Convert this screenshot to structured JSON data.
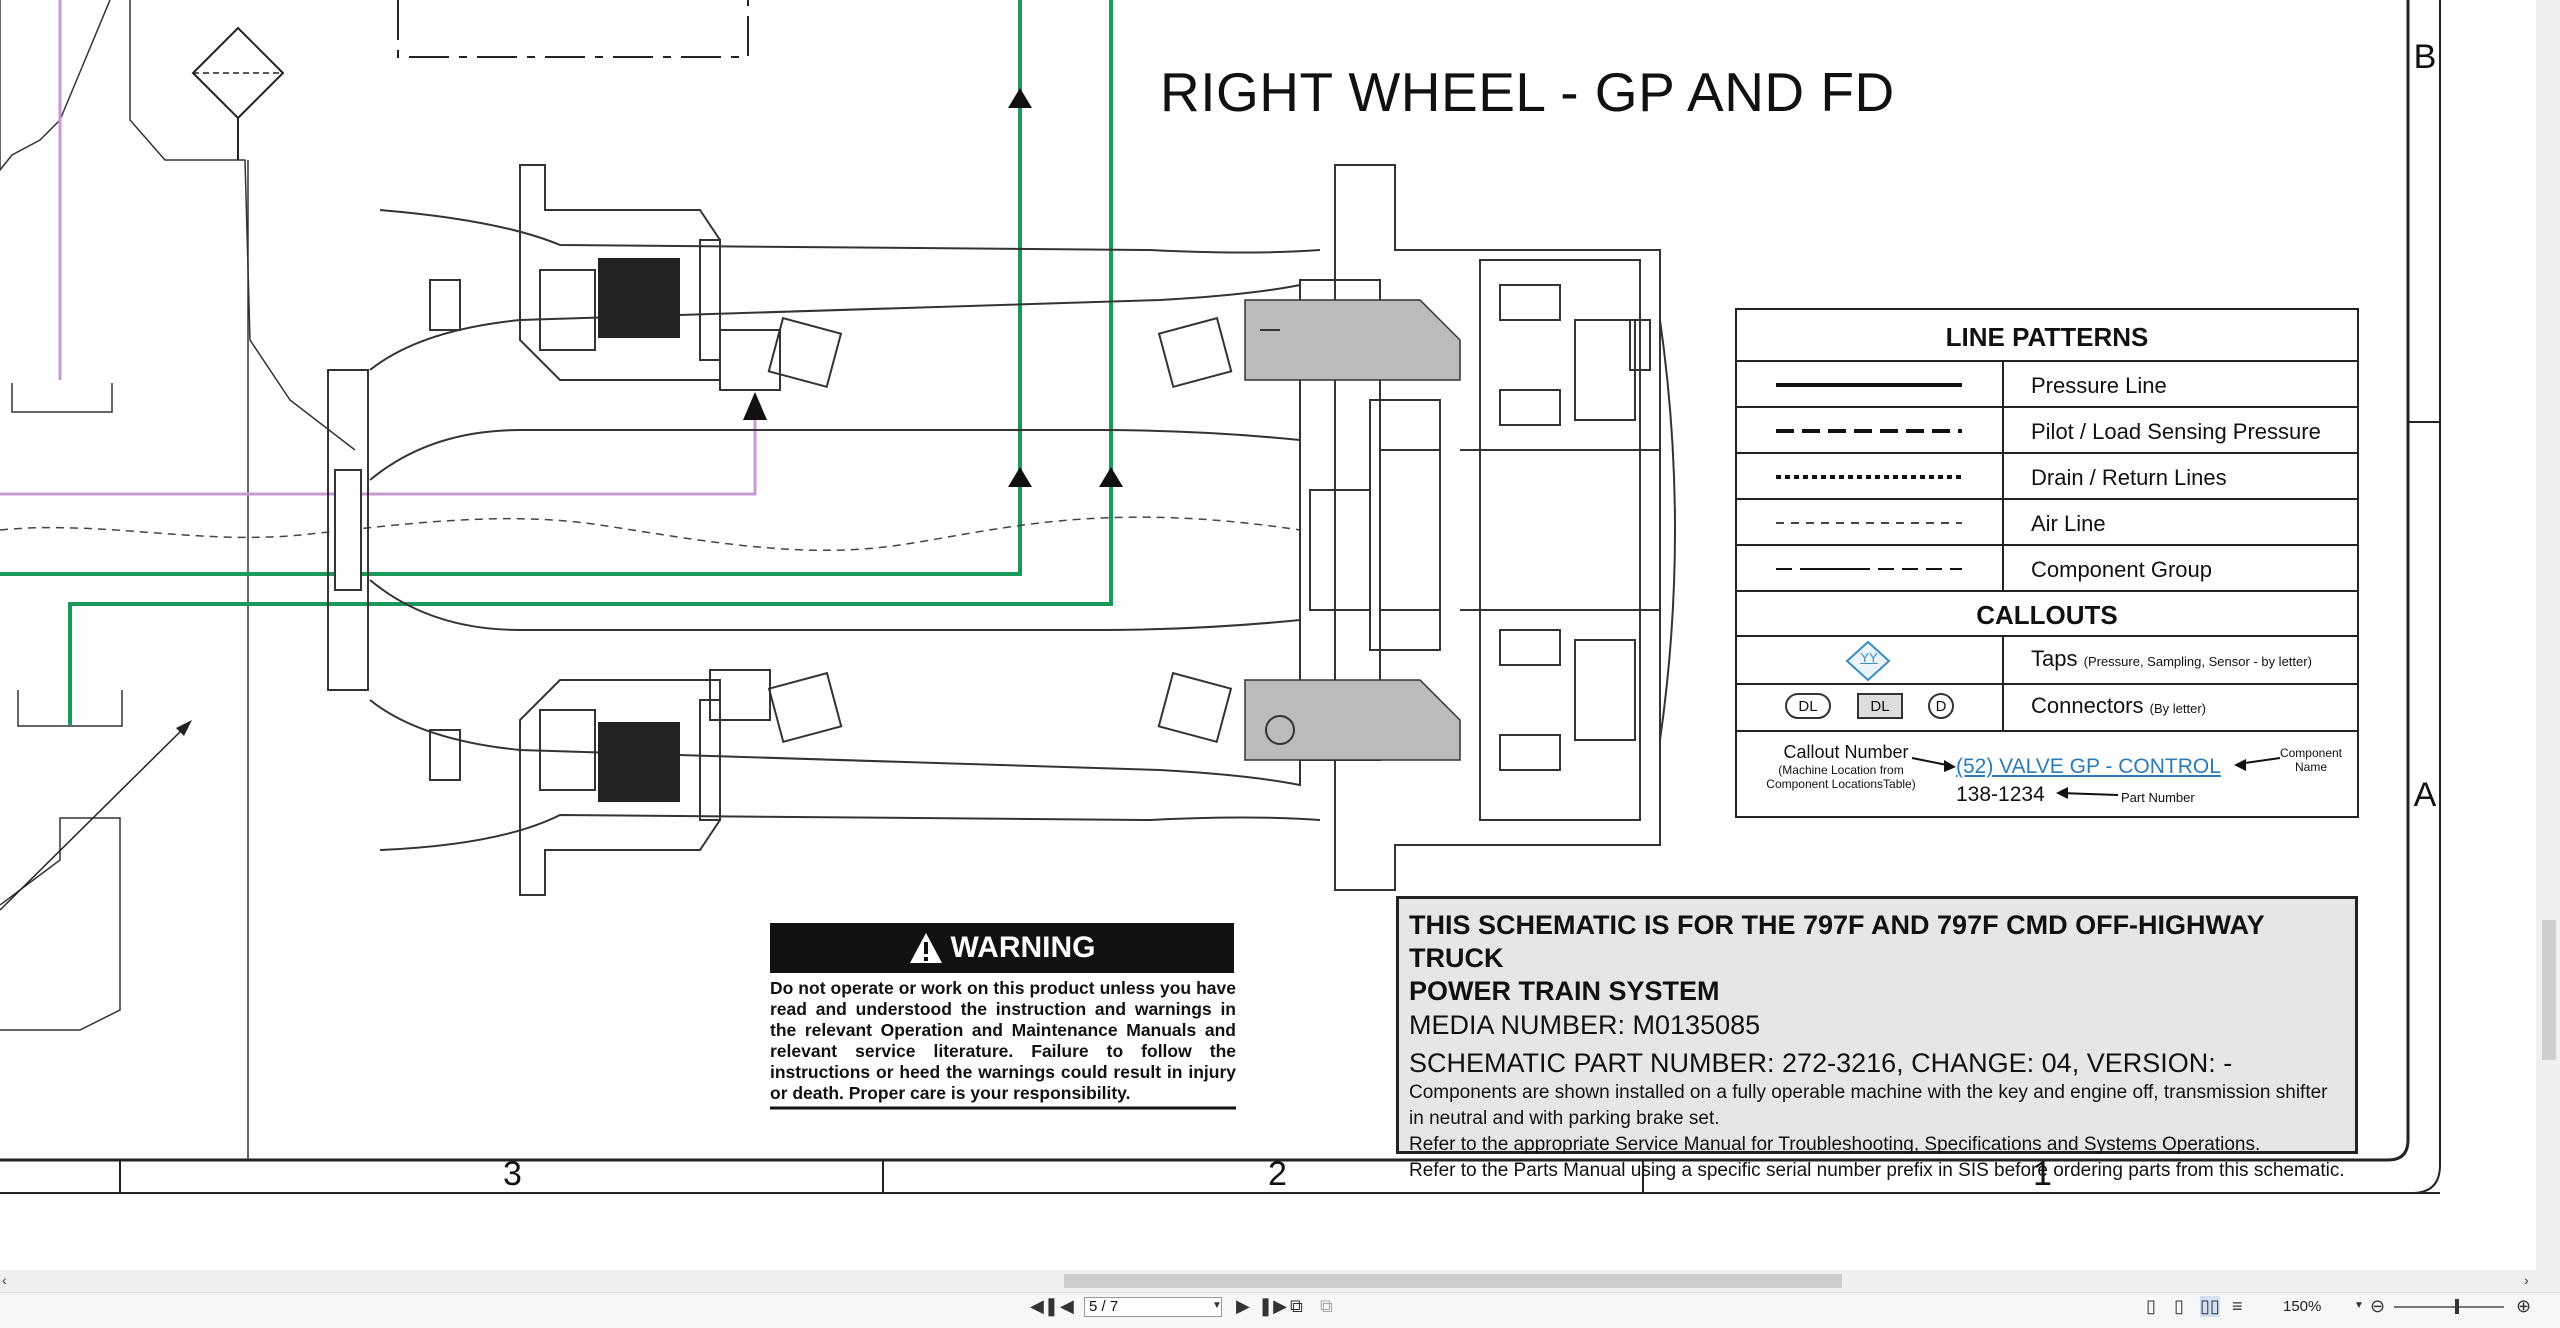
{
  "drawing": {
    "title": "RIGHT WHEEL - GP AND FD",
    "zones": {
      "b": "B",
      "a": "A"
    },
    "columns": [
      "3",
      "2",
      "1"
    ]
  },
  "legend": {
    "line_patterns_title": "LINE PATTERNS",
    "lines": [
      "Pressure Line",
      "Pilot / Load Sensing Pressure",
      "Drain / Return Lines",
      "Air Line",
      "Component Group"
    ],
    "callouts_title": "CALLOUTS",
    "taps_label": "Taps",
    "taps_note": "(Pressure, Sampling, Sensor - by letter)",
    "taps_symbol": "YY",
    "connectors_label": "Connectors",
    "connectors_note": "(By letter)",
    "connector_symbols": [
      "DL",
      "DL",
      "D"
    ],
    "callout_number_label": "Callout Number",
    "callout_number_note": "(Machine Location from Component LocationsTable)",
    "callout_example": "(52) VALVE GP - CONTROL",
    "component_name_label": "Component Name",
    "part_number_example": "138-1234",
    "part_number_label": "Part Number"
  },
  "warning": {
    "heading": "WARNING",
    "text": "Do not operate or work on this product unless you have read and understood the instruction and warnings in the relevant Operation and Maintenance Manuals and relevant service literature. Failure to follow the instructions or heed the warnings could result in injury or death. Proper care is your responsibility."
  },
  "info": {
    "line1": "THIS SCHEMATIC IS FOR THE 797F AND 797F CMD OFF-HIGHWAY TRUCK",
    "line2": "POWER TRAIN SYSTEM",
    "media": "MEDIA NUMBER: M0135085",
    "part": "SCHEMATIC PART NUMBER: 272-3216, CHANGE: 04, VERSION: -",
    "note1": "Components are shown installed on a fully operable machine with the key and engine off, transmission shifter in neutral and with parking brake set.",
    "note2": "Refer to the appropriate Service Manual for Troubleshooting, Specifications and Systems Operations.",
    "note3": "Refer to the Parts Manual using a specific serial number prefix in SIS before ordering parts from this schematic."
  },
  "viewer": {
    "page": "5 / 7",
    "zoom": "150%",
    "icons": [
      "first-page-icon",
      "prev-page-icon",
      "next-page-icon",
      "last-page-icon",
      "single-page-icon",
      "continuous-icon",
      "two-page-icon",
      "two-page-continuous-icon",
      "zoom-out-icon",
      "zoom-in-icon"
    ]
  },
  "colors": {
    "hydraulic_green": "#1a9a5a",
    "pilot_purple": "#c79ad4",
    "info_bg": "#e6e6e6",
    "link_blue": "#2b7bb9"
  }
}
